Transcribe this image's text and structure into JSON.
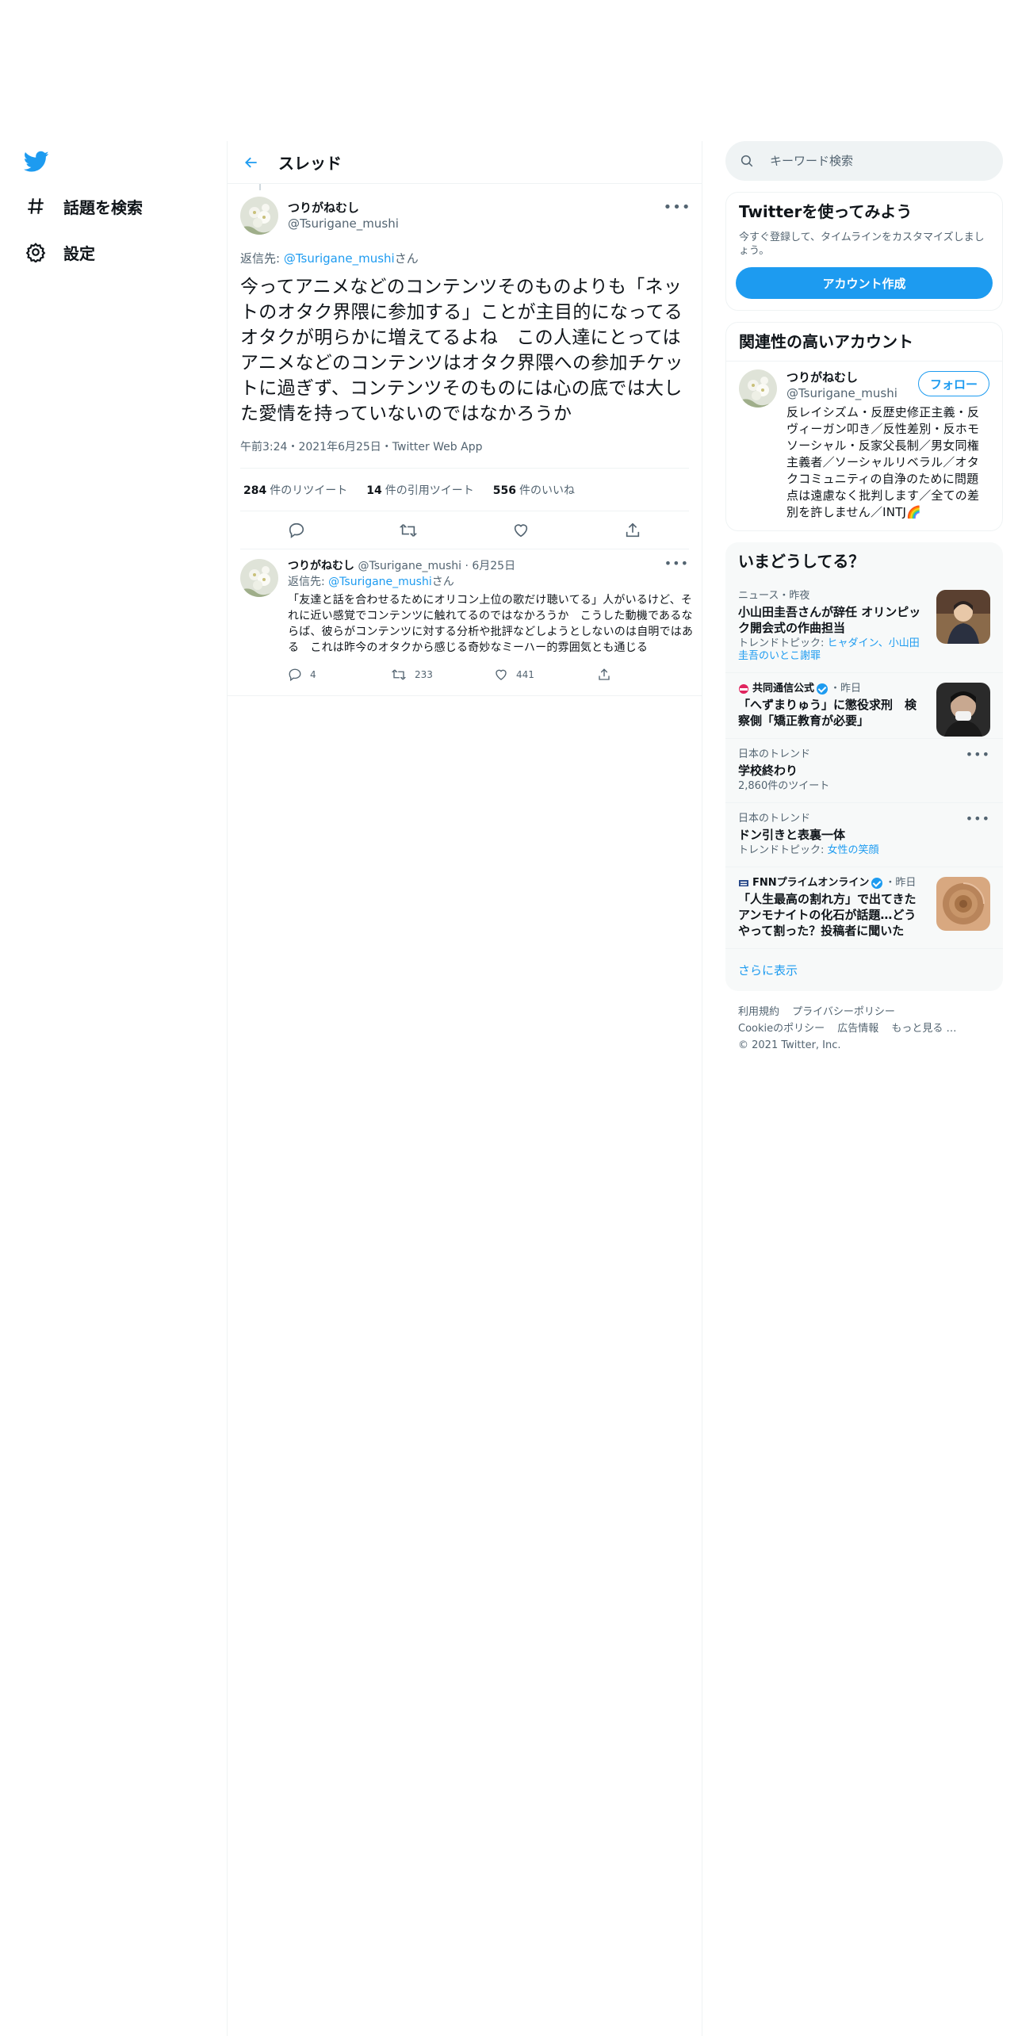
{
  "nav": {
    "items": [
      {
        "label": "話題を検索",
        "icon": "hashtag-icon"
      },
      {
        "label": "設定",
        "icon": "gear-icon"
      }
    ]
  },
  "header": {
    "title": "スレッド"
  },
  "focus_tweet": {
    "name": "つりがねむし",
    "handle": "@Tsurigane_mushi",
    "reply_prefix": "返信先: ",
    "reply_handle": "@Tsurigane_mushi",
    "reply_suffix": "さん",
    "text": "今ってアニメなどのコンテンツそのものよりも「ネットのオタク界隈に参加する」ことが主目的になってるオタクが明らかに増えてるよね　この人達にとってはアニメなどのコンテンツはオタク界隈への参加チケットに過ぎず、コンテンツそのものには心の底では大した愛情を持っていないのではなかろうか",
    "meta": "午前3:24・2021年6月25日・Twitter Web App",
    "retweets": "284",
    "retweets_label": "件のリツイート",
    "quotes": "14",
    "quotes_label": "件の引用ツイート",
    "likes": "556",
    "likes_label": "件のいいね"
  },
  "reply_tweet": {
    "name": "つりがねむし",
    "handle_date": "@Tsurigane_mushi · 6月25日",
    "reply_prefix": "返信先: ",
    "reply_handle": "@Tsurigane_mushi",
    "reply_suffix": "さん",
    "text": "「友達と話を合わせるためにオリコン上位の歌だけ聴いてる」人がいるけど、それに近い感覚でコンテンツに触れてるのではなかろうか　こうした動機であるならば、彼らがコンテンツに対する分析や批評などしようとしないのは自明ではある　これは昨今のオタクから感じる奇妙なミーハー的雰囲気とも通じる",
    "replies": "4",
    "retweets": "233",
    "likes": "441"
  },
  "search": {
    "placeholder": "キーワード検索"
  },
  "signup": {
    "title": "Twitterを使ってみよう",
    "desc": "今すぐ登録して、タイムラインをカスタマイズしましょう。",
    "button": "アカウント作成"
  },
  "related": {
    "title": "関連性の高いアカウント",
    "name": "つりがねむし",
    "handle": "@Tsurigane_mushi",
    "follow": "フォロー",
    "bio": "反レイシズム・反歴史修正主義・反ヴィーガン叩き／反性差別・反ホモソーシャル・反家父長制／男女同権主義者／ソーシャルリベラル／オタクコミュニティの自浄のために問題点は遠慮なく批判します／全ての差別を許しません／INTJ🌈"
  },
  "trends": {
    "title": "いまどうしてる？",
    "items": [
      {
        "top": "ニュース・昨夜",
        "title": "小山田圭吾さんが辞任 オリンピック開会式の作曲担当",
        "sub_prefix": "トレンドトピック: ",
        "sub_link": "ヒャダイン、小山田圭吾のいとこ謝罪"
      },
      {
        "source": "共同通信公式",
        "time": "・昨日",
        "title": "「へずまりゅう」に懲役求刑　検察側「矯正教育が必要」"
      },
      {
        "top": "日本のトレンド",
        "title": "学校終わり",
        "sub": "2,860件のツイート"
      },
      {
        "top": "日本のトレンド",
        "title": "ドン引きと表裏一体",
        "sub_prefix": "トレンドトピック: ",
        "sub_link": "女性の笑顔"
      },
      {
        "source": "FNNプライムオンライン",
        "time": "・昨日",
        "title": "「人生最高の割れ方」で出てきたアンモナイトの化石が話題…どうやって割った？投稿者に聞いた"
      }
    ],
    "show_more": "さらに表示"
  },
  "footer": {
    "links": [
      "利用規約",
      "プライバシーポリシー",
      "Cookieのポリシー",
      "広告情報",
      "もっと見る …"
    ],
    "copyright": "© 2021 Twitter, Inc."
  },
  "colors": {
    "accent": "#1d9bf0",
    "text": "#0f1419",
    "secondary": "#536471",
    "border": "#eff3f4"
  }
}
